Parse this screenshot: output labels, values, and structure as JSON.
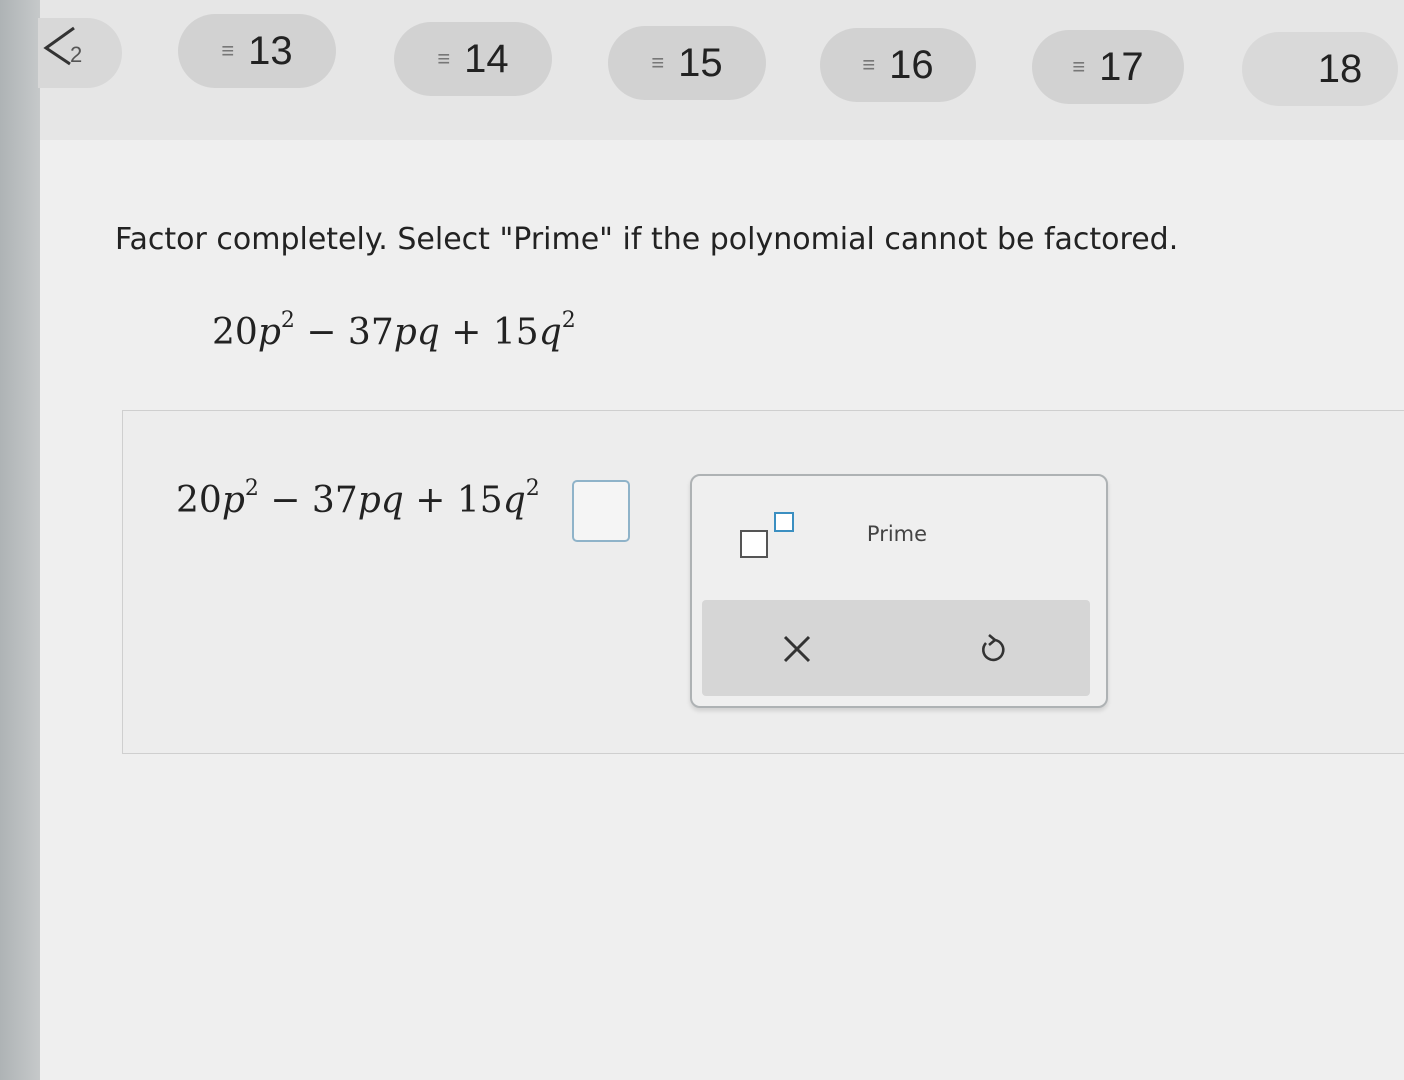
{
  "nav": {
    "questions": [
      {
        "number": "13",
        "flagged": true
      },
      {
        "number": "14",
        "flagged": true
      },
      {
        "number": "15",
        "flagged": true
      },
      {
        "number": "16",
        "flagged": true
      },
      {
        "number": "17",
        "flagged": true
      },
      {
        "number": "18",
        "flagged": false
      }
    ],
    "flag_glyph": "≡"
  },
  "problem": {
    "instruction": "Factor completely. Select \"Prime\" if the polynomial cannot be factored.",
    "expression": {
      "coef1": "20",
      "var1": "p",
      "exp1": "2",
      "op1": " − ",
      "coef2": "37",
      "var2": "pq",
      "op2": " + ",
      "coef3": "15",
      "var3": "q",
      "exp3": "2"
    }
  },
  "answer": {
    "equals": "=",
    "value": ""
  },
  "keypad": {
    "prime_label": "Prime",
    "clear_glyph": "×",
    "undo_icon": "undo-icon",
    "exponent_icon": "exponent-template-icon"
  },
  "colors": {
    "accent": "#3b8fc1",
    "pill_bg": "#d2d2d2"
  }
}
